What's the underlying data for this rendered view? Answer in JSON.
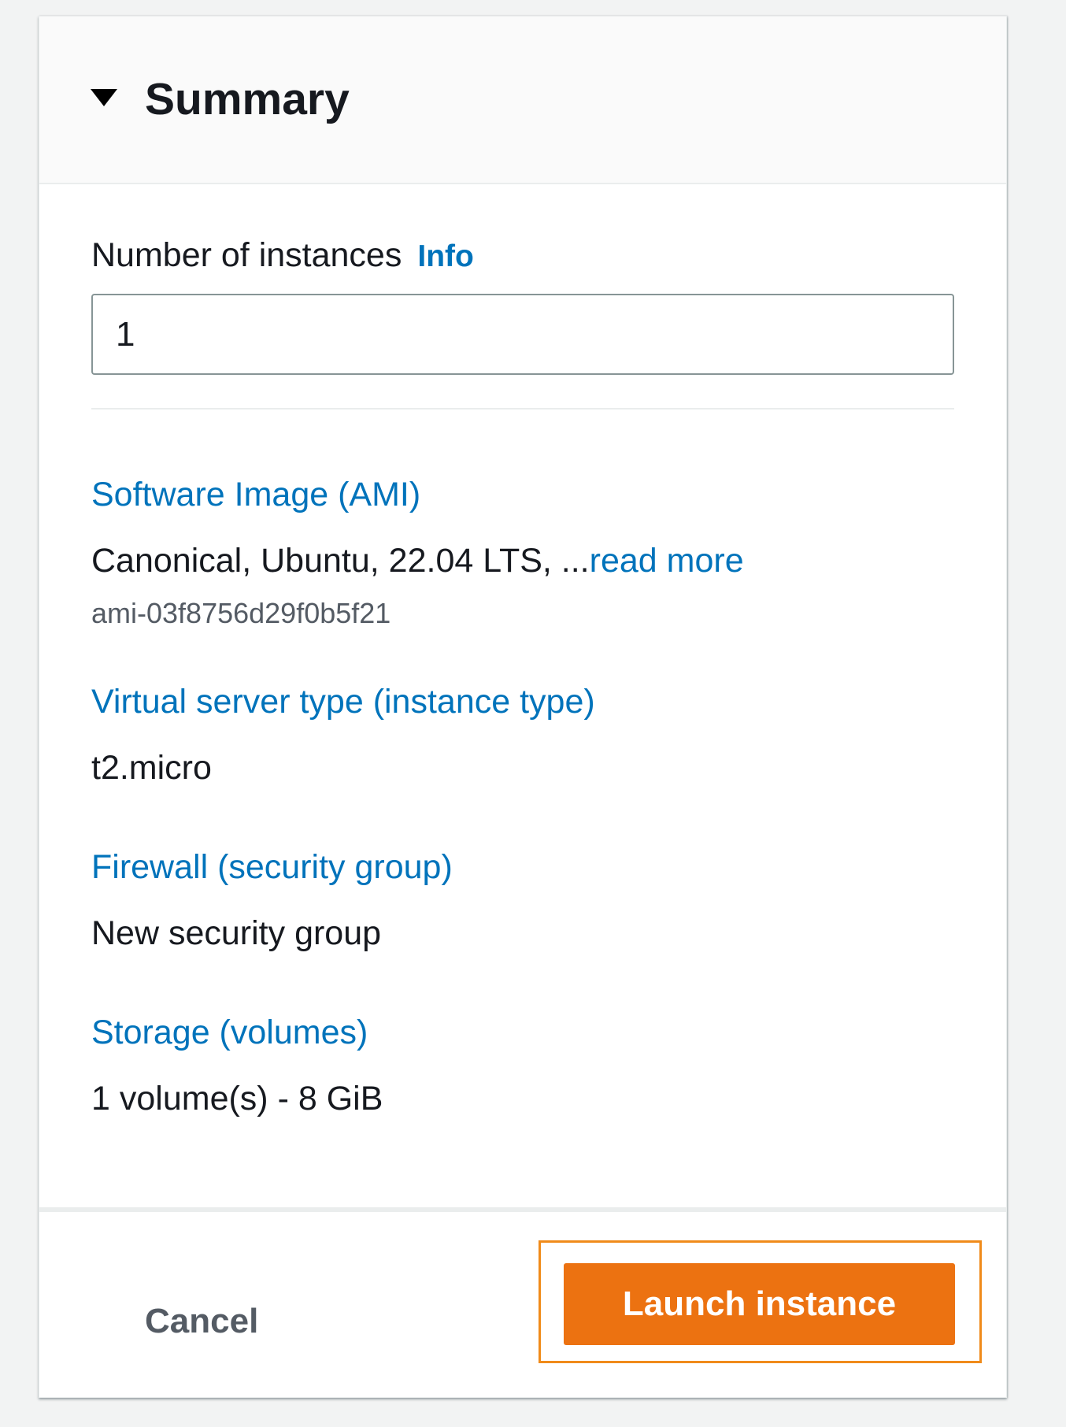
{
  "panel": {
    "title": "Summary"
  },
  "instances": {
    "label": "Number of instances",
    "info_link": "Info",
    "value": "1"
  },
  "sections": [
    {
      "title": "Software Image (AMI)",
      "value": "Canonical, Ubuntu, 22.04 LTS, ...",
      "read_more": "read more",
      "sub_value": "ami-03f8756d29f0b5f21"
    },
    {
      "title": "Virtual server type (instance type)",
      "value": "t2.micro"
    },
    {
      "title": "Firewall (security group)",
      "value": "New security group"
    },
    {
      "title": "Storage (volumes)",
      "value": "1 volume(s) - 8 GiB"
    }
  ],
  "footer": {
    "cancel_label": "Cancel",
    "launch_label": "Launch instance"
  },
  "icons": {
    "collapse": "caret-down-icon"
  },
  "colors": {
    "link": "#0073bb",
    "primary_button": "#ec7211",
    "focus_ring": "#f08b1a"
  }
}
